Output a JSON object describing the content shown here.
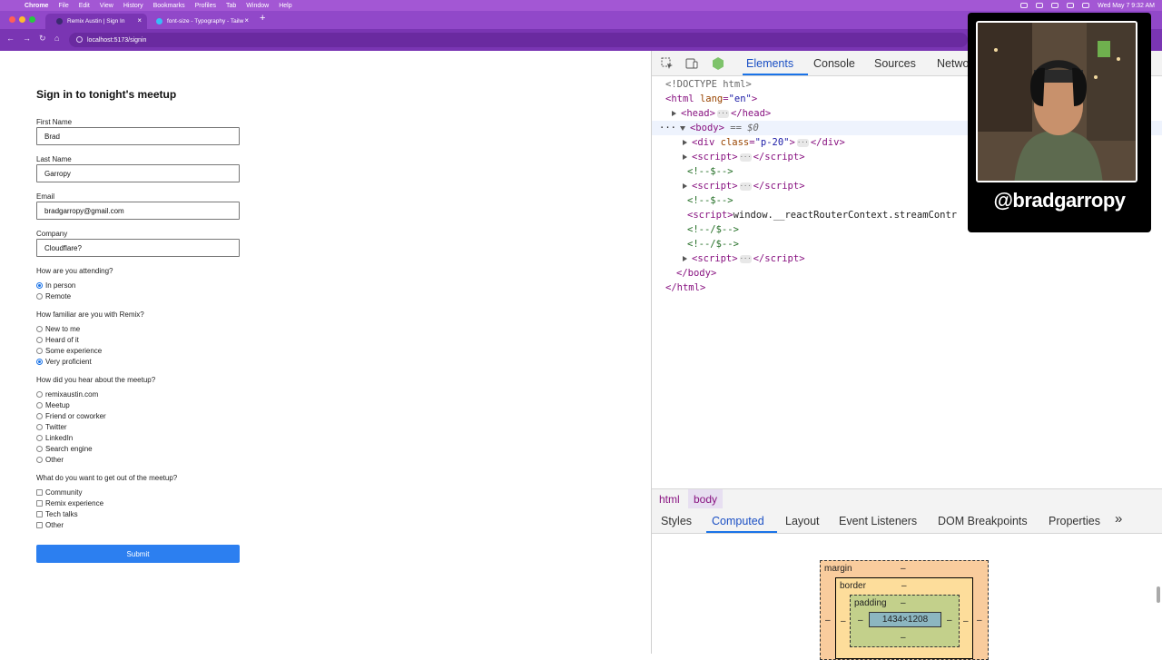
{
  "menubar": {
    "apple_glyph": "",
    "items": [
      "Chrome",
      "File",
      "Edit",
      "View",
      "History",
      "Bookmarks",
      "Profiles",
      "Tab",
      "Window",
      "Help"
    ],
    "clock": "Wed May 7  9:32 AM"
  },
  "browser": {
    "tabs": [
      {
        "title": "Remix Austin | Sign In",
        "active": true
      },
      {
        "title": "font-size - Typography - Tailw",
        "active": false
      }
    ],
    "new_tab_glyph": "+",
    "url": "localhost:5173/signin",
    "nav": {
      "back": "←",
      "forward": "→",
      "reload": "↻",
      "home": "⌂"
    }
  },
  "form": {
    "title": "Sign in to tonight's meetup",
    "fields": [
      {
        "label": "First Name",
        "value": "Brad"
      },
      {
        "label": "Last Name",
        "value": "Garropy"
      },
      {
        "label": "Email",
        "value": "bradgarropy@gmail.com"
      },
      {
        "label": "Company",
        "value": "Cloudflare?"
      }
    ],
    "attending": {
      "question": "How are you attending?",
      "options": [
        "In person",
        "Remote"
      ],
      "selected": "In person"
    },
    "familiarity": {
      "question": "How familiar are you with Remix?",
      "options": [
        "New to me",
        "Heard of it",
        "Some experience",
        "Very proficient"
      ],
      "selected": "Very proficient"
    },
    "source": {
      "question": "How did you hear about the meetup?",
      "options": [
        "remixaustin.com",
        "Meetup",
        "Friend or coworker",
        "Twitter",
        "LinkedIn",
        "Search engine",
        "Other"
      ]
    },
    "goals": {
      "question": "What do you want to get out of the meetup?",
      "options": [
        "Community",
        "Remix experience",
        "Tech talks",
        "Other"
      ]
    },
    "submit_label": "Submit"
  },
  "devtools": {
    "tabs": [
      "Elements",
      "Console",
      "Sources",
      "Netwo"
    ],
    "active_tab": "Elements",
    "dom": {
      "doctype": "<!DOCTYPE html>",
      "html_open_tag": "html",
      "html_attr": "lang",
      "html_attr_value": "\"en\"",
      "head": "head",
      "body": "body",
      "body_selected_marker": " == $0",
      "div_tag": "div",
      "div_attr": "class",
      "div_attr_value": "\"p-20\"",
      "script_tag": "script",
      "comment_open": "<!--$-->",
      "comment_close": "<!--/$-->",
      "inline_script": "window.__reactRouterContext.streamContr",
      "row_dots": "···"
    },
    "breadcrumbs": [
      "html",
      "body"
    ],
    "sub_tabs": [
      "Styles",
      "Computed",
      "Layout",
      "Event Listeners",
      "DOM Breakpoints",
      "Properties"
    ],
    "active_sub_tab": "Computed",
    "overflow_glyph": "»",
    "box_model": {
      "margin_label": "margin",
      "border_label": "border",
      "padding_label": "padding",
      "content_size": "1434×1208",
      "dash": "–"
    }
  },
  "webcam": {
    "handle": "@bradgarropy"
  },
  "colors": {
    "menubar": "#a357d4",
    "accent": "#2c7ff0",
    "devtools_active": "#1a4fc4"
  }
}
